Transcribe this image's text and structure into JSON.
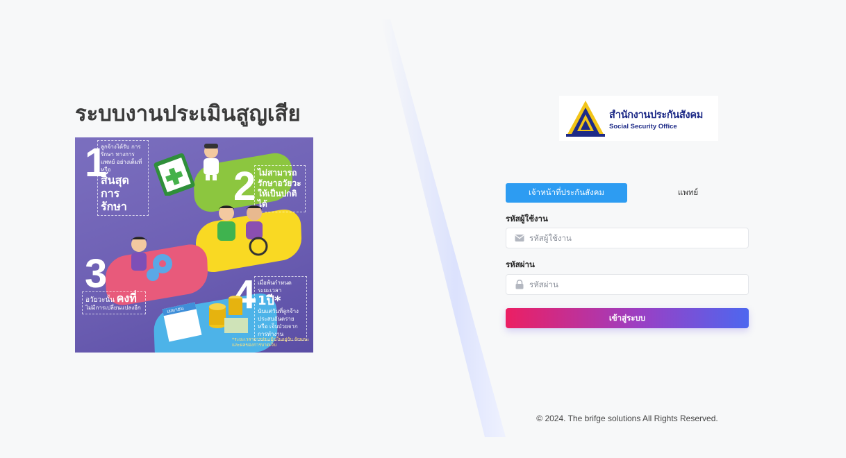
{
  "left": {
    "title": "ระบบงานประเมินสูญเสีย",
    "infographic": {
      "steps": [
        {
          "number": "1",
          "text": "ลูกจ้างได้รับ การรักษา ทางการแพทย์ อย่างเต็มที่หรือ",
          "highlight": "สิ้นสุด การรักษา"
        },
        {
          "number": "2",
          "text": "",
          "highlight": "ไม่สามารถ รักษาอวัยวะ ให้เป็นปกติได้"
        },
        {
          "number": "3",
          "text": "อวัยวะนั้น",
          "highlight": "คงที่",
          "sub": "ไม่มีการเปลี่ยนแปลงอีก"
        },
        {
          "number": "4",
          "text": "เมื่อพ้นกำหนดระยะเวลา",
          "highlight": "1ปี*",
          "sub": "นับแต่วันที่ลูกจ้าง ประสบอันตรายหรือ เจ็บป่วยจากการทำงาน"
        }
      ],
      "calendar_label": "เมษายน",
      "footnote": "*ระยะเวลาการประเมินในอยู่กับ ลักษณะและผลของการบาดเจ็บ"
    }
  },
  "logo": {
    "thai_name": "สำนักงานประกันสังคม",
    "english_name": "Social Security Office"
  },
  "tabs": [
    {
      "label": "เจ้าหน้าที่ประกันสังคม",
      "active": true
    },
    {
      "label": "แพทย์",
      "active": false
    }
  ],
  "form": {
    "username_label": "รหัสผู้ใช้งาน",
    "username_placeholder": "รหัสผู้ใช้งาน",
    "password_label": "รหัสผ่าน",
    "password_placeholder": "รหัสผ่าน",
    "submit_label": "เข้าสู่ระบบ"
  },
  "footer": {
    "copyright": "© 2024. The brifge solutions All Rights Reserved."
  },
  "colors": {
    "tab_active": "#2d9cf2",
    "button_gradient_start": "#ec1f63",
    "button_gradient_end": "#4d67ef",
    "logo_blue": "#1d2a87",
    "logo_gold": "#f2c418"
  }
}
